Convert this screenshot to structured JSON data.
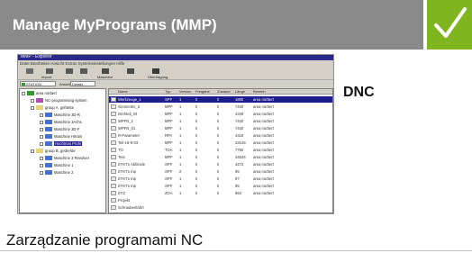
{
  "header": {
    "title": "Manage MyPrograms (MMP)",
    "background": "#8a8a8a",
    "check_color": "#7fb51e",
    "icon": "check-icon"
  },
  "side_label": "DNC",
  "caption": "Zarządzanie programami NC",
  "screenshot": {
    "window_title": "MMP - Explorer",
    "menu": "Datei  Bearbeiten  Ansicht  Extras  Systemeinstellungen  Hilfe",
    "toolbar": [
      {
        "label": "",
        "icon": "folder-icon",
        "color": "#6a6a6a"
      },
      {
        "label": "Import",
        "icon": "import-icon",
        "color": "#5a5a5a"
      },
      {
        "label": "",
        "icon": "back-icon",
        "color": "#5a5a5a"
      },
      {
        "label": "",
        "icon": "forward-icon",
        "color": "#5a5a5a"
      },
      {
        "label": "Maschine",
        "icon": "machine-icon",
        "color": "#4a4a4a"
      },
      {
        "label": "",
        "icon": "chart-icon",
        "color": "#4a4a4a"
      },
      {
        "label": "Übertragung",
        "icon": "transfer-icon",
        "color": "#3a3a3a"
      }
    ],
    "address": {
      "value": "STATION",
      "label": "Ansicht",
      "select": "Details"
    },
    "tree": [
      {
        "label": "area norbert",
        "level": 0,
        "color": "#2e9a2e"
      },
      {
        "label": "NC-programming system",
        "level": 1,
        "color": "#b04fb0"
      },
      {
        "label": "group A, gefräste",
        "level": 1,
        "color": "#e8d27a"
      },
      {
        "label": "Maschine 3D-R",
        "level": 2,
        "color": "#4a6fc8"
      },
      {
        "label": "Maschine 3Achs",
        "level": 2,
        "color": "#4a6fc8"
      },
      {
        "label": "Maschine 3D-F",
        "level": 2,
        "color": "#4a6fc8"
      },
      {
        "label": "Maschine Hitrain",
        "level": 2,
        "color": "#4a6fc8"
      },
      {
        "label": "Hochtroni Profil",
        "level": 2,
        "color": "#4a6fc8",
        "selected": true
      },
      {
        "label": "group B, gedrehte",
        "level": 1,
        "color": "#e8d27a"
      },
      {
        "label": "Maschine 3 Revolver",
        "level": 2,
        "color": "#4a6fc8"
      },
      {
        "label": "Maschine 1",
        "level": 2,
        "color": "#4a6fc8"
      },
      {
        "label": "Maschine 2",
        "level": 2,
        "color": "#4a6fc8"
      }
    ],
    "columns": [
      "Name",
      "Typ",
      "Version",
      "Freigabe",
      "Zustand",
      "Länge",
      "Bereich"
    ],
    "rows": [
      {
        "cells": [
          "Werkzeuge_1",
          "SPF",
          "1",
          "0",
          "0",
          "1800",
          "area norbert"
        ],
        "selected": true
      },
      {
        "cells": [
          "Geometrie_2",
          "MPF",
          "1",
          "0",
          "0",
          "7440",
          "area norbert"
        ]
      },
      {
        "cells": [
          "Drehteil_04",
          "MPF",
          "1",
          "0",
          "0",
          "4349",
          "area norbert"
        ]
      },
      {
        "cells": [
          "WPFN_1",
          "MPF",
          "1",
          "0",
          "0",
          "7440",
          "area norbert"
        ]
      },
      {
        "cells": [
          "WPFN_01",
          "MPF",
          "1",
          "0",
          "0",
          "7440",
          "area norbert"
        ]
      },
      {
        "cells": [
          "R-Parameter",
          "RPA",
          "1",
          "0",
          "0",
          "4318",
          "area norbert"
        ]
      },
      {
        "cells": [
          "Teil-18-6-03",
          "MPF",
          "1",
          "0",
          "0",
          "33145",
          "area norbert"
        ]
      },
      {
        "cells": [
          "TO",
          "TOA",
          "1",
          "0",
          "0",
          "7750",
          "area norbert"
        ]
      },
      {
        "cells": [
          "Test",
          "MPF",
          "1",
          "0",
          "0",
          "34534",
          "area norbert"
        ]
      },
      {
        "cells": [
          "ZYKT1 Ablimale",
          "SPF",
          "1",
          "0",
          "0",
          "4272",
          "area norbert"
        ]
      },
      {
        "cells": [
          "ZYKT1 Inp",
          "SPF",
          "2",
          "0",
          "0",
          "95",
          "area norbert"
        ]
      },
      {
        "cells": [
          "ZYKT1 Inp",
          "SPF",
          "1",
          "0",
          "0",
          "97",
          "area norbert"
        ]
      },
      {
        "cells": [
          "ZYKT1 Inp",
          "SPF",
          "1",
          "0",
          "0",
          "95",
          "area norbert"
        ]
      },
      {
        "cells": [
          "ZYZ",
          "ZOA",
          "1",
          "0",
          "0",
          "964",
          "area norbert"
        ]
      },
      {
        "cells": [
          "Projekt",
          "",
          "",
          "",
          "",
          "",
          ""
        ]
      },
      {
        "cells": [
          "Schraubenfahrt",
          "",
          "",
          "",
          "",
          "",
          ""
        ]
      }
    ]
  }
}
